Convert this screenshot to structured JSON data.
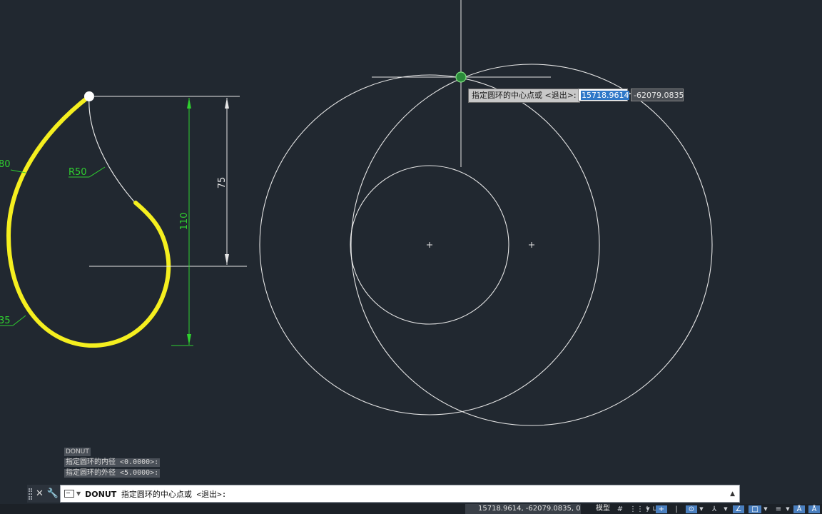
{
  "drawing": {
    "dim_r80": "80",
    "dim_r50": "R50",
    "dim_r35": "35",
    "dim_75": "75",
    "dim_110": "110"
  },
  "dynamic_input": {
    "prompt": "指定圆环的中心点或 <退出>:",
    "x_value": "15718.9614",
    "y_value": "-62079.0835"
  },
  "command_history": [
    "DONUT",
    "指定圆环的内径 <0.0000>:",
    "指定圆环的外径 <5.0000>:"
  ],
  "command_line": {
    "command": "DONUT",
    "prompt": "指定圆环的中心点或 <退出>:"
  },
  "status_bar": {
    "coordinates": "15718.9614, -62079.0835, 0.0000",
    "model_label": "模型"
  },
  "colors": {
    "background": "#212830",
    "highlight_yellow": "#f5ef1f",
    "dimension_green": "#2fd12f",
    "geometry_white": "#e6e6e6"
  }
}
